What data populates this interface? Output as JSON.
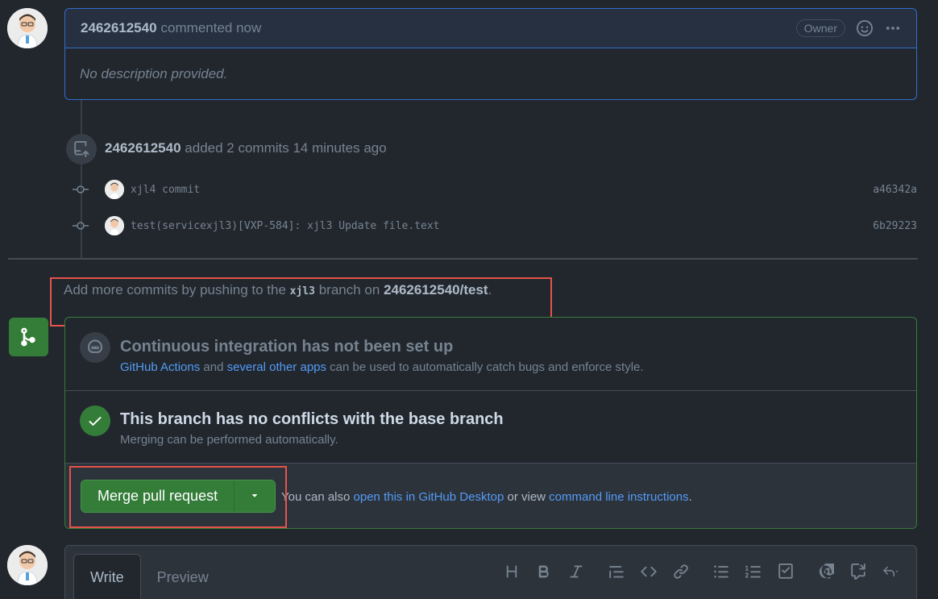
{
  "comment": {
    "author": "2462612540",
    "meta": "commented now",
    "badge": "Owner",
    "body": "No description provided."
  },
  "commits_event": {
    "author": "2462612540",
    "text": "added 2 commits 14 minutes ago",
    "commits": [
      {
        "message": "xjl4 commit",
        "sha": "a46342a"
      },
      {
        "message": "test(servicexjl3)[VXP-584]: xjl3 Update file.text",
        "sha": "6b29223"
      }
    ]
  },
  "push_hint": {
    "prefix": "Add more commits by pushing to the",
    "branch": "xjl3",
    "middle": "branch on",
    "repo": "2462612540/test",
    "suffix": "."
  },
  "merge": {
    "ci_title": "Continuous integration has not been set up",
    "ci_link1": "GitHub Actions",
    "ci_and": "and",
    "ci_link2": "several other apps",
    "ci_rest": "can be used to automatically catch bugs and enforce style.",
    "conflict_title": "This branch has no conflicts with the base branch",
    "conflict_sub": "Merging can be performed automatically.",
    "button_label": "Merge pull request",
    "alt_prefix": "You can also",
    "alt_link1": "open this in GitHub Desktop",
    "alt_mid": "or view",
    "alt_link2": "command line instructions",
    "alt_suffix": "."
  },
  "editor": {
    "tabs": [
      "Write",
      "Preview"
    ]
  },
  "colors": {
    "background": "#22272e",
    "accent_blue": "#316dca",
    "success_green": "#347d39",
    "highlight_red": "#e5534b",
    "link": "#539bf5"
  }
}
